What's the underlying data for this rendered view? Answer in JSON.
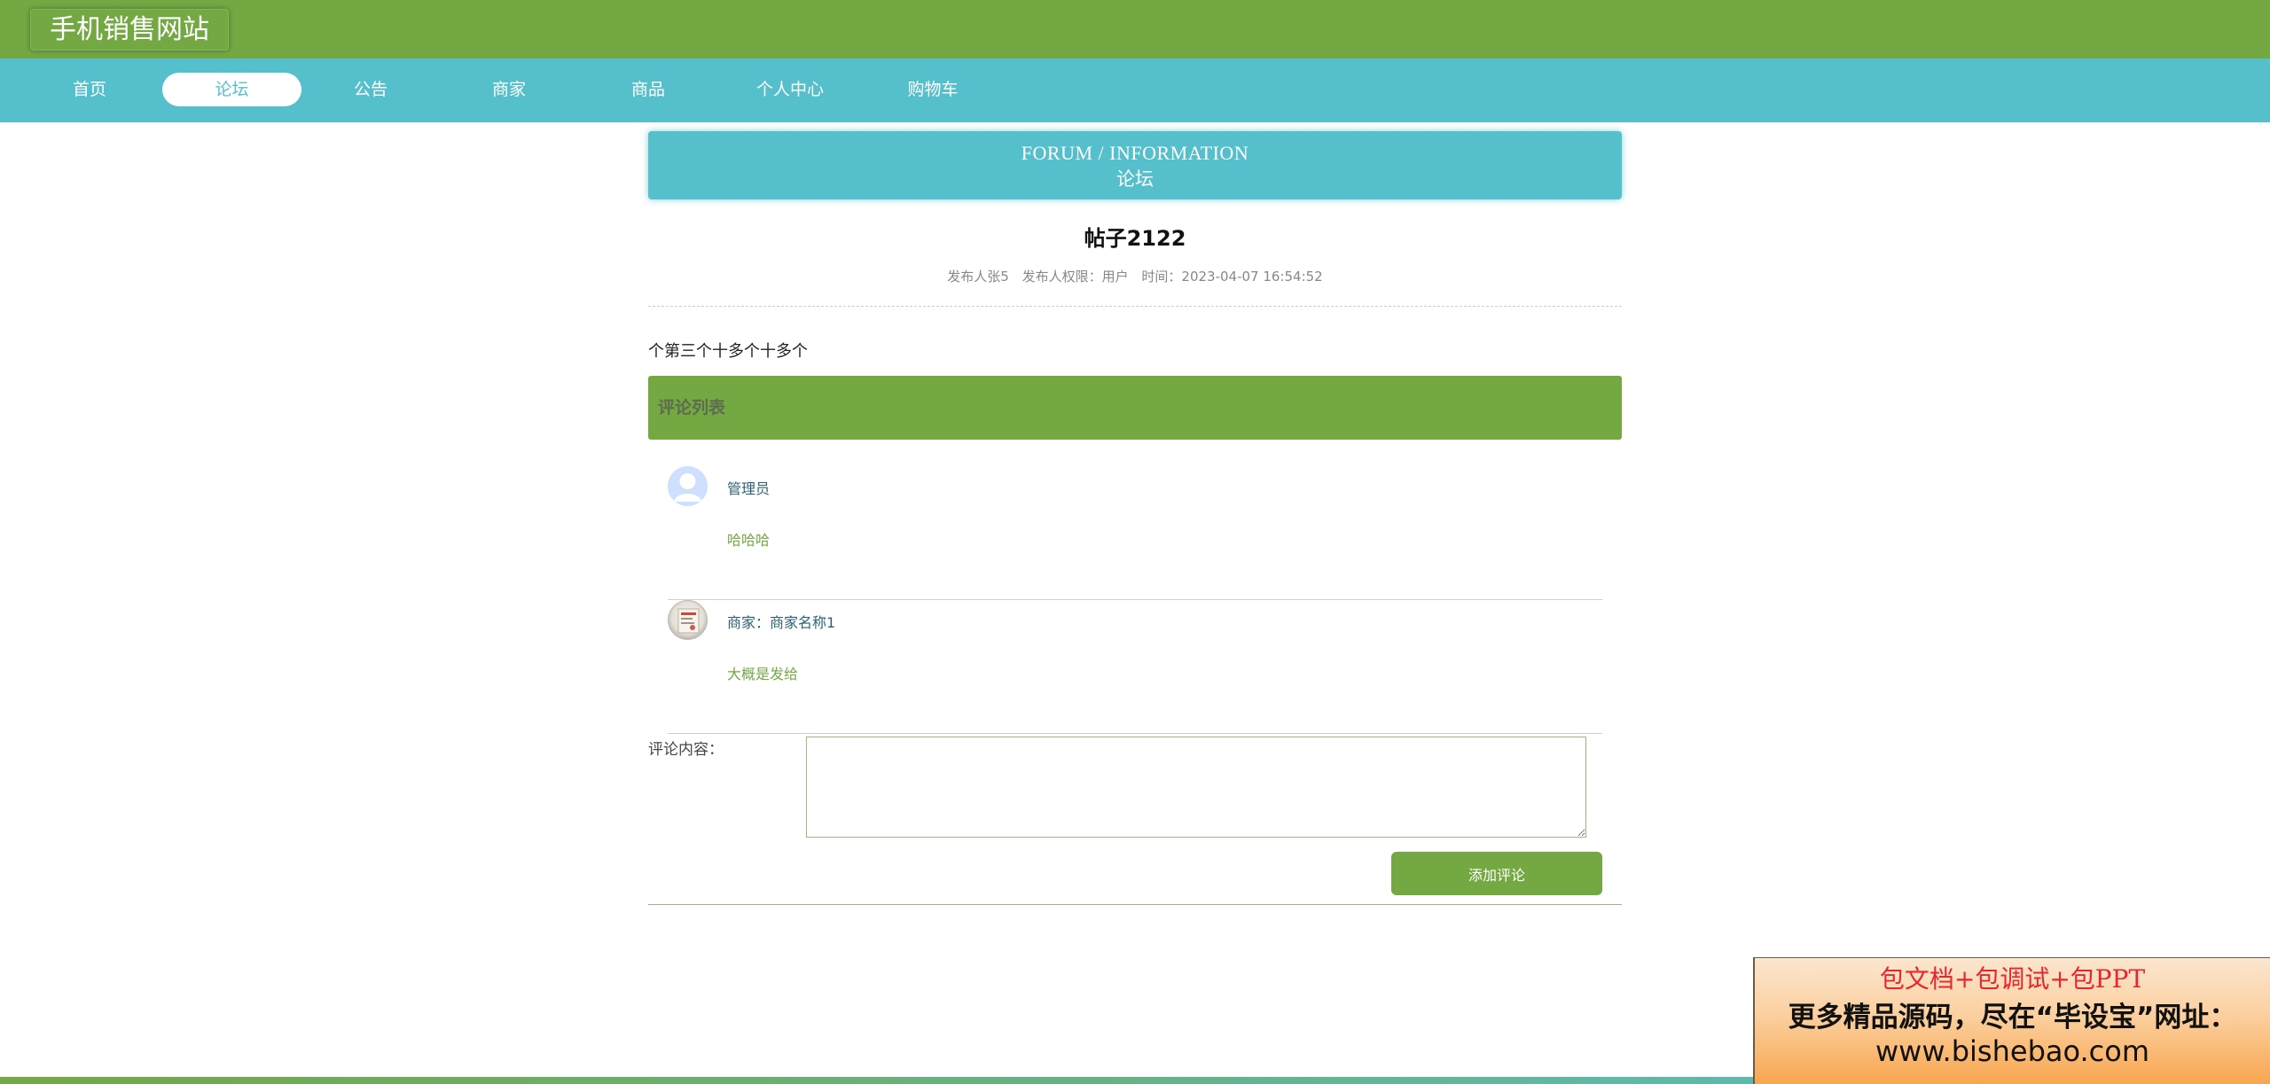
{
  "header": {
    "site_title": "手机销售网站"
  },
  "nav": {
    "items": [
      {
        "label": "首页"
      },
      {
        "label": "论坛",
        "active": true
      },
      {
        "label": "公告"
      },
      {
        "label": "商家"
      },
      {
        "label": "商品"
      },
      {
        "label": "个人中心"
      },
      {
        "label": "购物车"
      }
    ]
  },
  "banner": {
    "en": "FORUM / INFORMATION",
    "cn": "论坛"
  },
  "post": {
    "title": "帖子2122",
    "author": "发布人张5",
    "role": "发布人权限：用户",
    "time": "时间：2023-04-07 16:54:52",
    "content": "个第三个十多个十多个"
  },
  "comments": {
    "header": "评论列表",
    "items": [
      {
        "name": "管理员",
        "text": "哈哈哈",
        "avatar": "default-user-avatar"
      },
      {
        "name": "商家：商家名称1",
        "text": "大概是发给",
        "avatar": "shop-avatar"
      }
    ]
  },
  "form": {
    "label": "评论内容：",
    "textarea_value": "",
    "submit_label": "添加评论"
  },
  "ad": {
    "line1": "包文档+包调试+包PPT",
    "line2": "更多精品源码，尽在“毕设宝”网址：",
    "line3": "www.bishebao.com"
  },
  "colors": {
    "green": "#73a843",
    "teal": "#55bfcb",
    "comment_text": "#73a843",
    "ad_red": "#e8262e"
  }
}
